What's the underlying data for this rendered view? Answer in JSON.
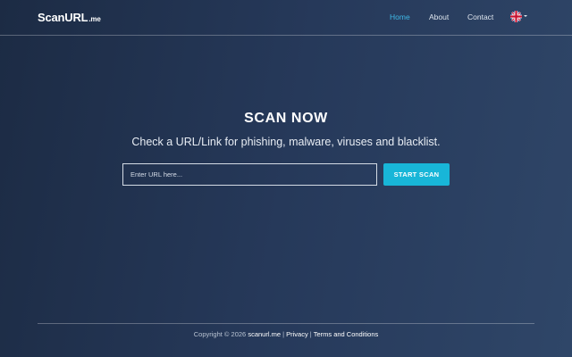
{
  "header": {
    "logo_main": "ScanURL",
    "logo_suffix": ".me",
    "nav": {
      "home": "Home",
      "about": "About",
      "contact": "Contact"
    },
    "language_icon": "uk-flag-icon"
  },
  "hero": {
    "title": "SCAN NOW",
    "subtitle": "Check a URL/Link for phishing, malware, viruses and blacklist.",
    "input_placeholder": "Enter URL here...",
    "input_value": "",
    "button_label": "START SCAN"
  },
  "footer": {
    "copyright": "Copyright © 2026",
    "site": "scanurl.me",
    "sep1": " | ",
    "privacy": "Privacy",
    "sep2": " | ",
    "terms": "Terms and Conditions"
  },
  "colors": {
    "accent": "#18b6d8",
    "active_nav": "#3fb8e6",
    "background_start": "#1c2b44",
    "background_end": "#2f4668"
  }
}
